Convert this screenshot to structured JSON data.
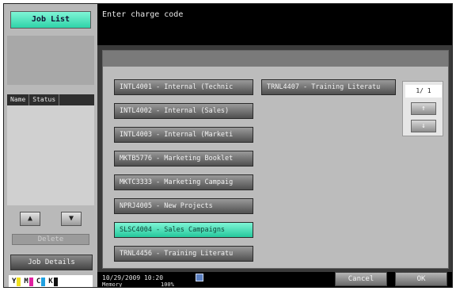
{
  "left_panel": {
    "job_list_label": "Job List",
    "status_headers": [
      "Name",
      "Status"
    ],
    "up_icon": "up-arrow-icon",
    "down_icon": "down-arrow-icon",
    "delete_label": "Delete",
    "job_details_label": "Job Details",
    "toner": [
      {
        "label": "Y",
        "color": "#f0e020"
      },
      {
        "label": "M",
        "color": "#e020a0"
      },
      {
        "label": "C",
        "color": "#20a0e0"
      },
      {
        "label": "K",
        "color": "#111111"
      }
    ]
  },
  "header": {
    "message": "Enter charge code"
  },
  "codes": {
    "left_column": [
      {
        "label": "INTL4001 - Internal (Technic",
        "selected": false
      },
      {
        "label": "INTL4002 - Internal (Sales)",
        "selected": false
      },
      {
        "label": "INTL4003 - Internal (Marketi",
        "selected": false
      },
      {
        "label": "MKTB5776 - Marketing Booklet",
        "selected": false
      },
      {
        "label": "MKTC3333 - Marketing Campaig",
        "selected": false
      },
      {
        "label": "NPRJ4005 - New Projects",
        "selected": false
      },
      {
        "label": "SLSC4004 - Sales Campaigns",
        "selected": true
      },
      {
        "label": "TRNL4456 - Training Literatu",
        "selected": false
      }
    ],
    "right_column": [
      {
        "label": "TRNL4407 - Training Literatu",
        "selected": false
      }
    ]
  },
  "pager": {
    "indicator": "1/ 1",
    "up_icon": "up-arrow-icon",
    "down_icon": "down-arrow-icon"
  },
  "bottom": {
    "datetime": "10/29/2009   10:20",
    "memory_label": "Memory",
    "memory_value": "100%",
    "cancel_label": "Cancel",
    "ok_label": "OK"
  }
}
